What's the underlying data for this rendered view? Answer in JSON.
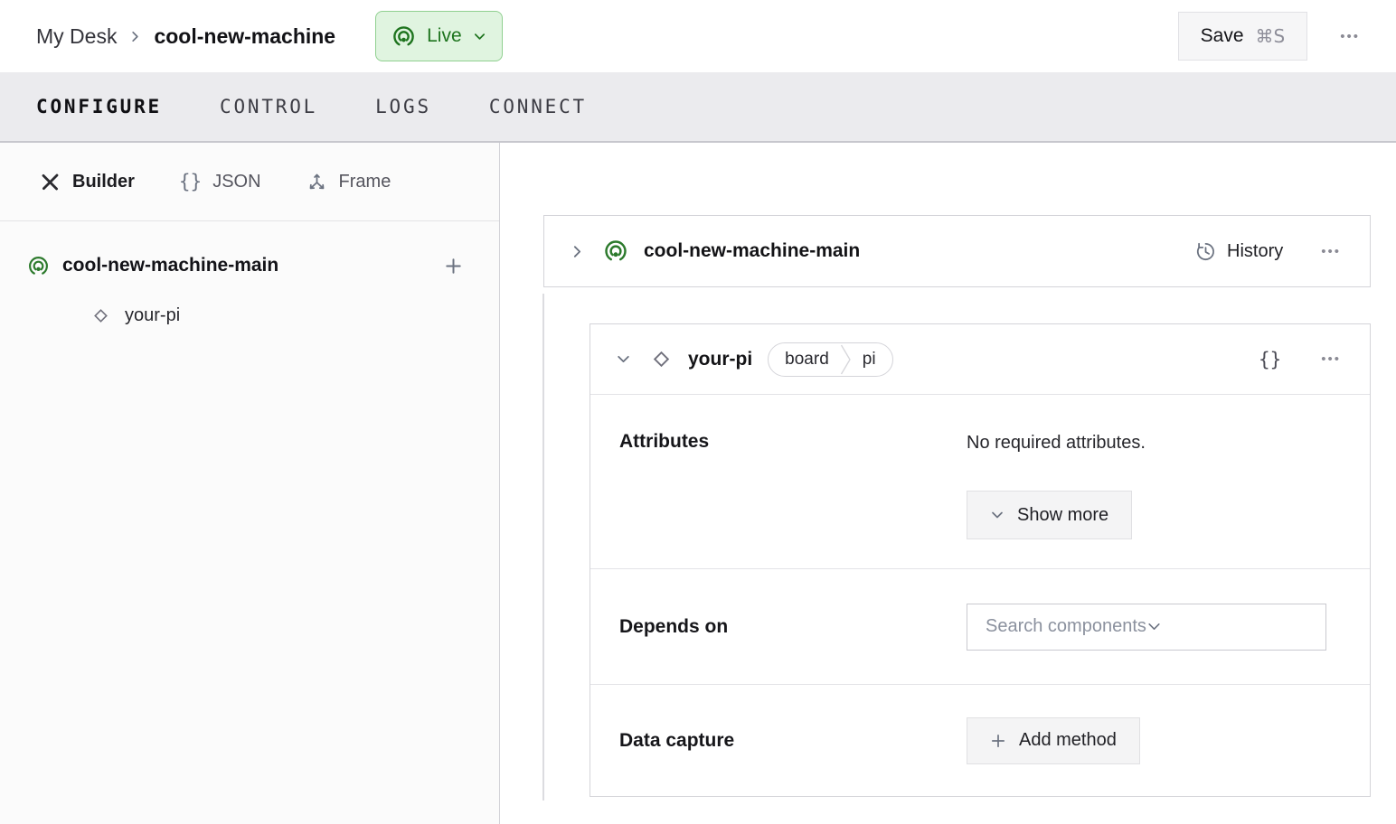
{
  "header": {
    "breadcrumb": {
      "parent": "My Desk",
      "current": "cool-new-machine"
    },
    "status": {
      "label": "Live"
    },
    "save": {
      "label": "Save",
      "shortcut": "⌘S"
    }
  },
  "tabs": [
    {
      "label": "CONFIGURE",
      "active": true
    },
    {
      "label": "CONTROL",
      "active": false
    },
    {
      "label": "LOGS",
      "active": false
    },
    {
      "label": "CONNECT",
      "active": false
    }
  ],
  "sidebar": {
    "views": [
      {
        "label": "Builder",
        "icon": "crossed-tools-icon",
        "active": true
      },
      {
        "label": "JSON",
        "icon": "braces-icon",
        "active": false
      },
      {
        "label": "Frame",
        "icon": "axes-icon",
        "active": false
      }
    ],
    "tree": {
      "machine": {
        "label": "cool-new-machine-main",
        "icon": "broadcast-icon"
      },
      "children": [
        {
          "label": "your-pi",
          "icon": "diamond-icon"
        }
      ]
    }
  },
  "main": {
    "machine_card": {
      "title": "cool-new-machine-main",
      "history_label": "History"
    },
    "component_card": {
      "title": "your-pi",
      "badge": {
        "type": "board",
        "model": "pi"
      },
      "attributes": {
        "label": "Attributes",
        "empty_text": "No required attributes.",
        "show_more_label": "Show more"
      },
      "depends_on": {
        "label": "Depends on",
        "placeholder": "Search components"
      },
      "data_capture": {
        "label": "Data capture",
        "add_label": "Add method"
      }
    }
  },
  "icons": {
    "ellipsis": "•••",
    "braces": "{}"
  },
  "colors": {
    "live_text_green": "#1e741e",
    "live_bg_green": "#e0f4e0",
    "live_border_green": "#90d090",
    "brand_icon_green": "#2c7a2c",
    "tabbar_bg": "#ebebee",
    "card_border": "#d4d4d9"
  }
}
